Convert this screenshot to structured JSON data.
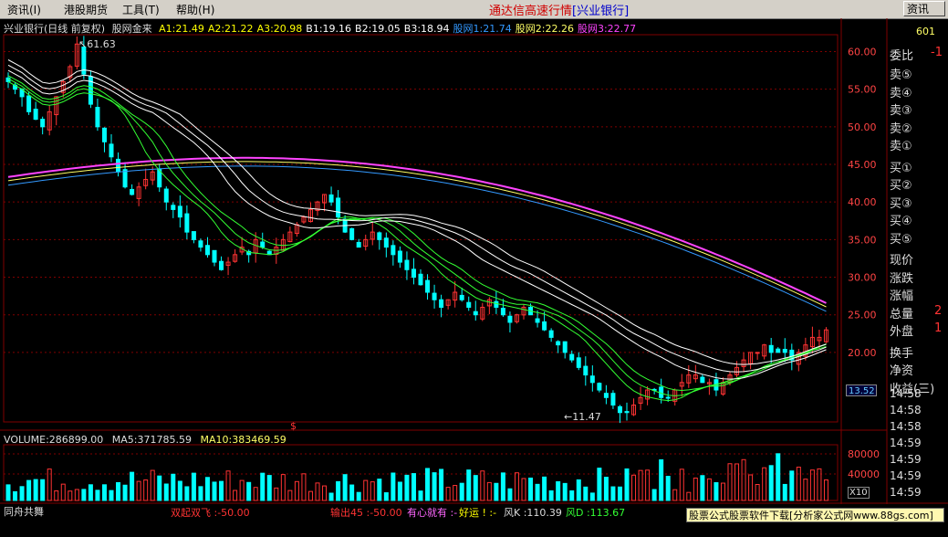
{
  "menubar": {
    "items": [
      "资讯(I)",
      "港股期货",
      "工具(T)",
      "帮助(H)"
    ],
    "app_title": "通达信高速行情",
    "app_title_suffix": "[兴业银行]",
    "right_button": "资讯"
  },
  "header": {
    "stock_label": "兴业银行(日线 前复权)",
    "indicator_name": "股网金来",
    "fields": [
      {
        "text": "A1:21.49",
        "color": "#ffff00"
      },
      {
        "text": "A2:21.22",
        "color": "#ffff00"
      },
      {
        "text": "A3:20.98",
        "color": "#ffff00"
      },
      {
        "text": "B1:19.16",
        "color": "#ffffff"
      },
      {
        "text": "B2:19.05",
        "color": "#ffffff"
      },
      {
        "text": "B3:18.94",
        "color": "#ffffff"
      },
      {
        "text": "股网1:21.74",
        "color": "#3399ff"
      },
      {
        "text": "股网2:22.26",
        "color": "#ffff66"
      },
      {
        "text": "股网3:22.77",
        "color": "#ff44ff"
      }
    ]
  },
  "annotations": {
    "high": "61.63",
    "low": "11.47",
    "dollar": "$"
  },
  "axis": {
    "price_ticks": [
      "60.00",
      "55.00",
      "50.00",
      "45.00",
      "40.00",
      "35.00",
      "30.00",
      "25.00",
      "20.00"
    ],
    "price_tag": "13.52",
    "volume_ticks": [
      "80000",
      "40000"
    ],
    "volume_unit": "X10"
  },
  "volume_header": {
    "volume": "VOLUME:286899.00",
    "ma5": "MA5:371785.59",
    "ma10": "MA10:383469.59"
  },
  "right_panel": {
    "corner": "601",
    "weibi": "委比",
    "weibi_val": "-1",
    "sells": [
      "卖⑤",
      "卖④",
      "卖③",
      "卖②",
      "卖①"
    ],
    "buys": [
      "买①",
      "买②",
      "买③",
      "买④",
      "买⑤"
    ],
    "stats": [
      "现价",
      "涨跌",
      "涨幅",
      "总量",
      "外盘"
    ],
    "stat_vals": [
      "",
      "",
      "",
      "2",
      "1"
    ],
    "extra": [
      "换手",
      "净资",
      "收益(三)"
    ],
    "times": [
      "14:58",
      "14:58",
      "14:58",
      "14:59",
      "14:59",
      "14:59",
      "14:59"
    ]
  },
  "bottom_bar": {
    "left": "同舟共舞",
    "items": [
      {
        "text": "双起双飞 :-50.00",
        "color": "#ff3333"
      },
      {
        "text": "输出45 :-50.00",
        "color": "#ff3333"
      },
      {
        "text": "有心就有 :-",
        "color": "#ff66ff"
      },
      {
        "text": "好运 ! :-",
        "color": "#ffff00"
      },
      {
        "text": "风K :110.39",
        "color": "#dddddd"
      },
      {
        "text": "风D :113.67",
        "color": "#33ff33"
      }
    ],
    "ad": "股票公式股票软件下载[分析家公式网www.88gs.com]"
  },
  "colors": {
    "up": "#ff3333",
    "down": "#00ffff",
    "grid": "#800000",
    "ma_white": "#ffffff",
    "ma_green": "#33ff33",
    "ma_magenta": "#ff44ff",
    "ma_yellow": "#ffff66",
    "ma_blue": "#3399ff"
  },
  "chart_data": {
    "type": "line",
    "ylim": [
      11,
      62
    ],
    "close_series": [
      56,
      55,
      54,
      52,
      51,
      50,
      52,
      54,
      56,
      58,
      61,
      57,
      53,
      50,
      48,
      46,
      44,
      42,
      41,
      42,
      43,
      44,
      42,
      40,
      39,
      38,
      36,
      35,
      34,
      33,
      32,
      31,
      32,
      33,
      34,
      33,
      35,
      34,
      33,
      34,
      35,
      36,
      37,
      38,
      39,
      40,
      41,
      40,
      38,
      36,
      35,
      34,
      35,
      36,
      35,
      34,
      33,
      32,
      31,
      30,
      29,
      28,
      27,
      26,
      27,
      28,
      27,
      26,
      25,
      26,
      27,
      26,
      25,
      24,
      25,
      26,
      25,
      24,
      23,
      22,
      21,
      20,
      19,
      18,
      17,
      16,
      15,
      14,
      13,
      12,
      12,
      13,
      14,
      15,
      15,
      14,
      14,
      15,
      16,
      17,
      17,
      16,
      16,
      15,
      16,
      17,
      18,
      19,
      20,
      20,
      21,
      20,
      20,
      20,
      19,
      20,
      21,
      22,
      22,
      23
    ],
    "axes": {
      "price_range": [
        11,
        62
      ]
    },
    "grid": true
  }
}
